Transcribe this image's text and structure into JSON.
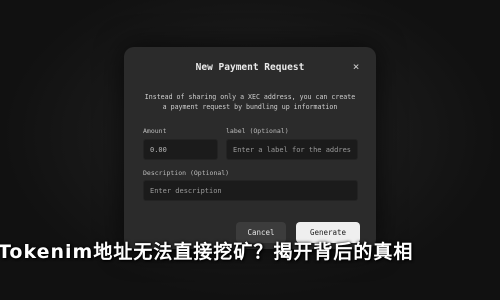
{
  "dialog": {
    "title": "New Payment Request",
    "close_icon": "×",
    "description_line1": "Instead of sharing only a XEC address, you can create",
    "description_line2": "a payment request by bundling up information",
    "amount": {
      "label": "Amount",
      "value": "0.00"
    },
    "label_field": {
      "label": "label (Optional)",
      "placeholder": "Enter a label for the address"
    },
    "description_field": {
      "label": "Description (Optional)",
      "placeholder": "Enter description"
    },
    "cancel_label": "Cancel",
    "generate_label": "Generate"
  },
  "banner": {
    "text": "Tokenim地址无法直接挖矿？揭开背后的真相"
  }
}
